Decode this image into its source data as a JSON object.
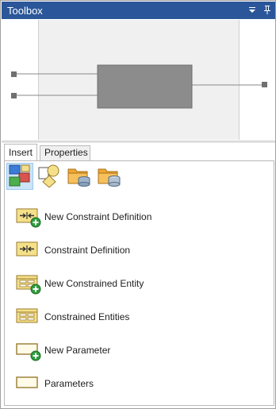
{
  "window": {
    "title": "Toolbox"
  },
  "titlebar_buttons": {
    "dropdown": "▼",
    "pin": "📌"
  },
  "tabs": [
    {
      "label": "Insert",
      "active": true
    },
    {
      "label": "Properties",
      "active": false
    }
  ],
  "tools": [
    {
      "icon": "constraint-diagram-icon",
      "selected": true
    },
    {
      "icon": "shape-nodes-icon",
      "selected": false
    },
    {
      "icon": "folder-database-icon",
      "selected": false
    },
    {
      "icon": "folder-database-alt-icon",
      "selected": false
    }
  ],
  "items": [
    {
      "label": "New Constraint Definition",
      "icon": "new-constraint-definition-icon"
    },
    {
      "label": "Constraint Definition",
      "icon": "constraint-definition-icon"
    },
    {
      "label": "New Constrained Entity",
      "icon": "new-constrained-entity-icon"
    },
    {
      "label": "Constrained Entities",
      "icon": "constrained-entities-icon"
    },
    {
      "label": "New Parameter",
      "icon": "new-parameter-icon"
    },
    {
      "label": "Parameters",
      "icon": "parameters-icon"
    }
  ],
  "colors": {
    "titlebar": "#2b579a",
    "icon_yellow": "#f5e08a",
    "icon_border": "#9a7b2e",
    "add_green": "#2e9e3e",
    "selection": "#cce4f7"
  }
}
